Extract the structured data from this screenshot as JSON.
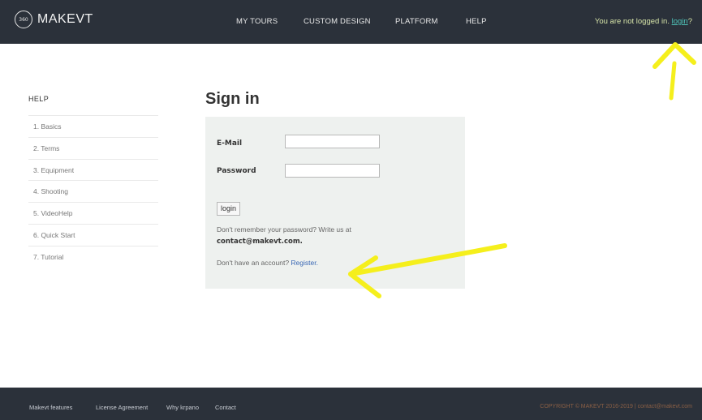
{
  "header": {
    "logo_mark": "360",
    "logo_text": "MAKEVT",
    "nav": [
      "MY TOURS",
      "CUSTOM DESIGN",
      "PLATFORM",
      "HELP"
    ],
    "auth_prefix": "You are not logged in.",
    "auth_link": "login",
    "auth_suffix": "?"
  },
  "sidebar": {
    "title": "HELP",
    "items": [
      "1. Basics",
      "2. Terms",
      "3. Equipment",
      "4. Shooting",
      "5. VideoHelp",
      "6. Quick Start",
      "7. Tutorial"
    ]
  },
  "main": {
    "title": "Sign in",
    "email_label": "E-Mail",
    "email_value": "",
    "password_label": "Password",
    "password_value": "",
    "login_button": "login",
    "remember_text": "Don't remember your password? Write us at",
    "contact_email": "contact@makevt.com.",
    "no_account_text": "Don't have an account?",
    "register_link": "Register."
  },
  "footer": {
    "links": [
      "Makevt features",
      "License Agreement",
      "Why krpano",
      "Contact"
    ],
    "copyright": "COPYRIGHT © MAKEVT 2016-2019 | contact@makevt.com"
  },
  "colors": {
    "header_bg": "#2b313a",
    "panel_bg": "#eef1ef",
    "annotation": "#f5ef1c",
    "link": "#3a68b5"
  }
}
